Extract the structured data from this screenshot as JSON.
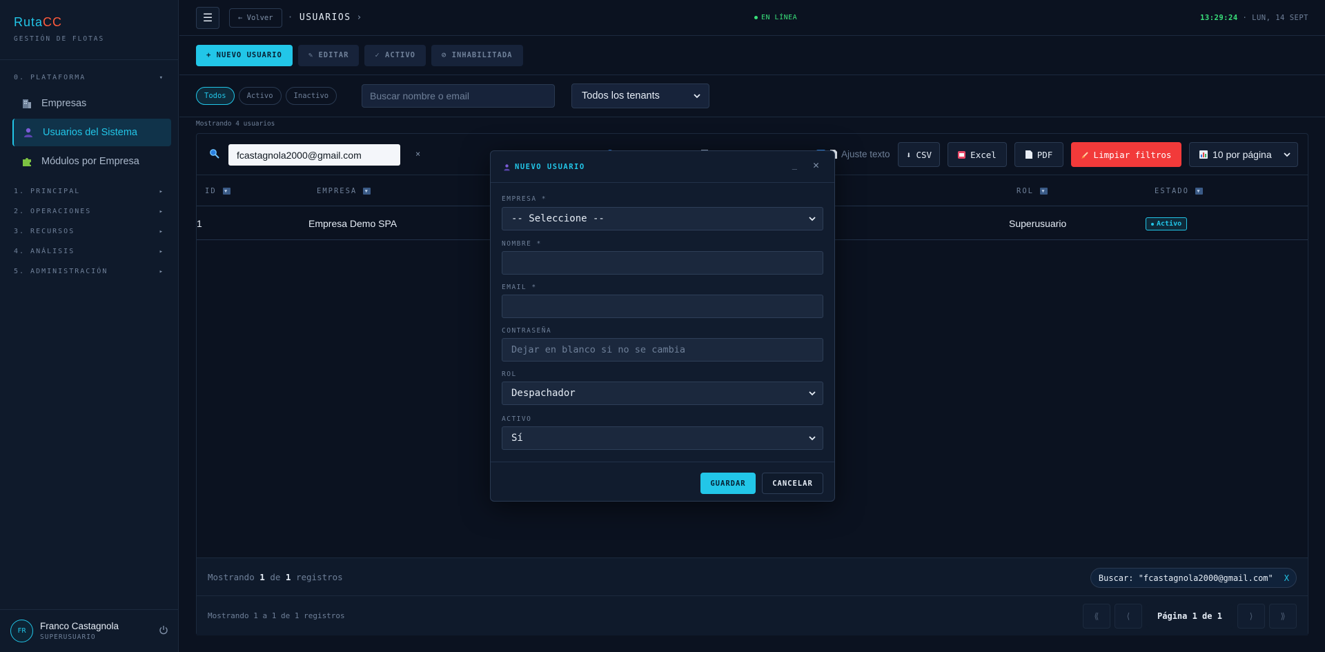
{
  "brand": {
    "name_a": "Ruta",
    "name_b": "CC",
    "subtitle": "GESTIÓN DE FLOTAS",
    "accent": "#22c6e8",
    "brand_red": "#ff5a3c"
  },
  "sidebar": {
    "groups": [
      {
        "label": "0. PLATAFORMA",
        "arrow": "▾"
      },
      {
        "label": "1. PRINCIPAL",
        "arrow": "▸"
      },
      {
        "label": "2. OPERACIONES",
        "arrow": "▸"
      },
      {
        "label": "3. RECURSOS",
        "arrow": "▸"
      },
      {
        "label": "4. ANÁLISIS",
        "arrow": "▸"
      },
      {
        "label": "5. ADMINISTRACIÓN",
        "arrow": "▸"
      }
    ],
    "items": [
      {
        "label": "Empresas",
        "icon": "building-icon"
      },
      {
        "label": "Usuarios del Sistema",
        "icon": "user-icon"
      },
      {
        "label": "Módulos por Empresa",
        "icon": "puzzle-icon"
      }
    ],
    "user": {
      "initials": "FR",
      "name": "Franco Castagnola",
      "role": "SUPERUSUARIO"
    }
  },
  "topbar": {
    "menu": "☰",
    "back": "← Volver",
    "crumb_sep": "·",
    "crumb": "USUARIOS",
    "crumb_chev": "›",
    "status": "EN LÍNEA",
    "time": "13:29:24",
    "date": "· LUN, 14 SEPT"
  },
  "actions": {
    "new": "+ NUEVO USUARIO",
    "edit": "✎ EDITAR",
    "active": "✓ ACTIVO",
    "disabled": "⊘ INHABILITADA"
  },
  "filters": {
    "pills": [
      "Todos",
      "Activo",
      "Inactivo"
    ],
    "search_placeholder": "Buscar nombre o email",
    "tenant": "Todos los tenants",
    "count": "Mostrando 4 usuarios"
  },
  "table": {
    "query": "fcastagnola2000@gmail.com",
    "clear": "×",
    "wrap_text": "Ajuste texto",
    "csv": "CSV",
    "excel": "Excel",
    "pdf": "PDF",
    "clear_filters": "Limpiar filtros",
    "per_page": "10 por página",
    "columns": [
      "ID",
      "EMPRESA",
      "ROL",
      "ESTADO"
    ],
    "rows": [
      {
        "id": "1",
        "empresa": "Empresa Demo SPA",
        "rol": "Superusuario",
        "estado": "Activo"
      }
    ],
    "footer_a": "Mostrando ",
    "footer_b": "1",
    "footer_c": " de ",
    "footer_d": "1",
    "footer_e": " registros",
    "chip": "Buscar: \"fcastagnola2000@gmail.com\"",
    "chip_x": "X",
    "footer2": "Mostrando 1 a 1 de 1 registros",
    "pager": {
      "first": "⟪",
      "prev": "⟨",
      "page": "Página 1 de 1",
      "next": "⟩",
      "last": "⟫"
    }
  },
  "modal": {
    "title": "NUEVO USUARIO",
    "minimize": "_",
    "close": "✕",
    "fields": {
      "empresa_label": "EMPRESA *",
      "empresa_value": "-- Seleccione --",
      "nombre_label": "NOMBRE *",
      "email_label": "EMAIL *",
      "password_label": "CONTRASEÑA",
      "password_placeholder": "Dejar en blanco si no se cambia",
      "rol_label": "ROL",
      "rol_value": "Despachador",
      "activo_label": "ACTIVO",
      "activo_value": "Sí"
    },
    "save": "GUARDAR",
    "cancel": "CANCELAR"
  }
}
